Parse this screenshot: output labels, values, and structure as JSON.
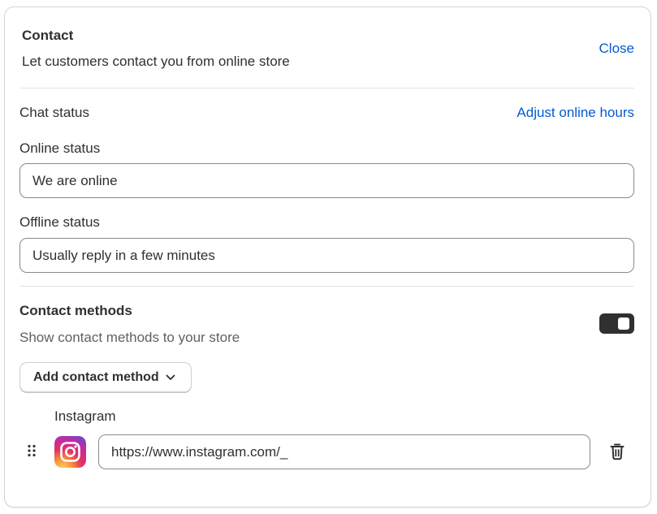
{
  "header": {
    "title": "Contact",
    "subtitle": "Let customers contact you from online store",
    "close_label": "Close"
  },
  "chat": {
    "status_label": "Chat status",
    "adjust_link": "Adjust online hours",
    "online_label": "Online status",
    "online_value": "We are online",
    "offline_label": "Offline status",
    "offline_value": "Usually reply in a few minutes"
  },
  "contact_methods": {
    "title": "Contact methods",
    "description": "Show contact methods to your store",
    "toggle_on": true,
    "add_button_label": "Add contact method",
    "items": [
      {
        "name": "Instagram",
        "icon": "instagram-icon",
        "url": "https://www.instagram.com/_"
      }
    ]
  },
  "colors": {
    "link": "#005bd3",
    "text": "#303030",
    "toggle_on": "#303030"
  }
}
